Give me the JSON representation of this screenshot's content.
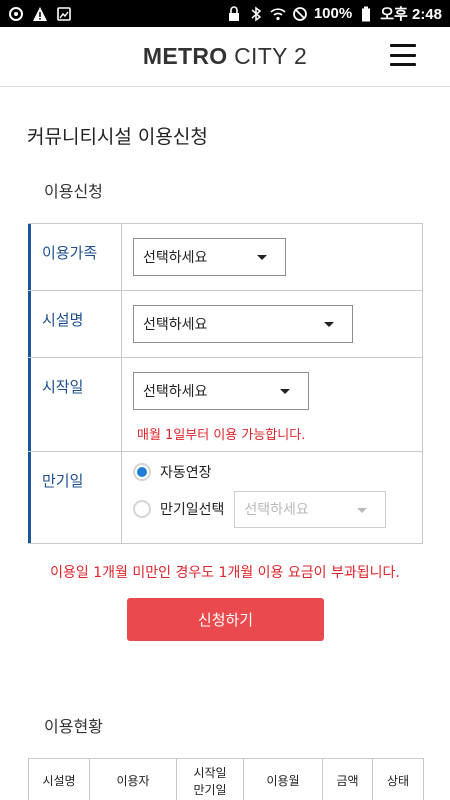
{
  "statusbar": {
    "battery_text": "100%",
    "time_text": "오후 2:48"
  },
  "header": {
    "logo_bold": "METRO",
    "logo_light": " CITY 2"
  },
  "page": {
    "title": "커뮤니티시설 이용신청"
  },
  "application": {
    "section_title": "이용신청",
    "rows": {
      "family": {
        "label": "이용가족",
        "select_value": "선택하세요"
      },
      "facility": {
        "label": "시설명",
        "select_value": "선택하세요"
      },
      "start": {
        "label": "시작일",
        "select_value": "선택하세요",
        "note": "매월 1일부터 이용 가능합니다."
      },
      "end": {
        "label": "만기일",
        "option_auto": "자동연장",
        "option_select": "만기일선택",
        "select_value": "선택하세요",
        "selected_option": "자동연장"
      }
    },
    "warning": "이용일 1개월 미만인 경우도 1개월 이용 요금이 부과됩니다.",
    "apply_label": "신청하기"
  },
  "usage": {
    "section_title": "이용현황",
    "columns": [
      "시설명",
      "이용자",
      "시작일\n만기일",
      "이용월",
      "금액",
      "상태"
    ]
  }
}
